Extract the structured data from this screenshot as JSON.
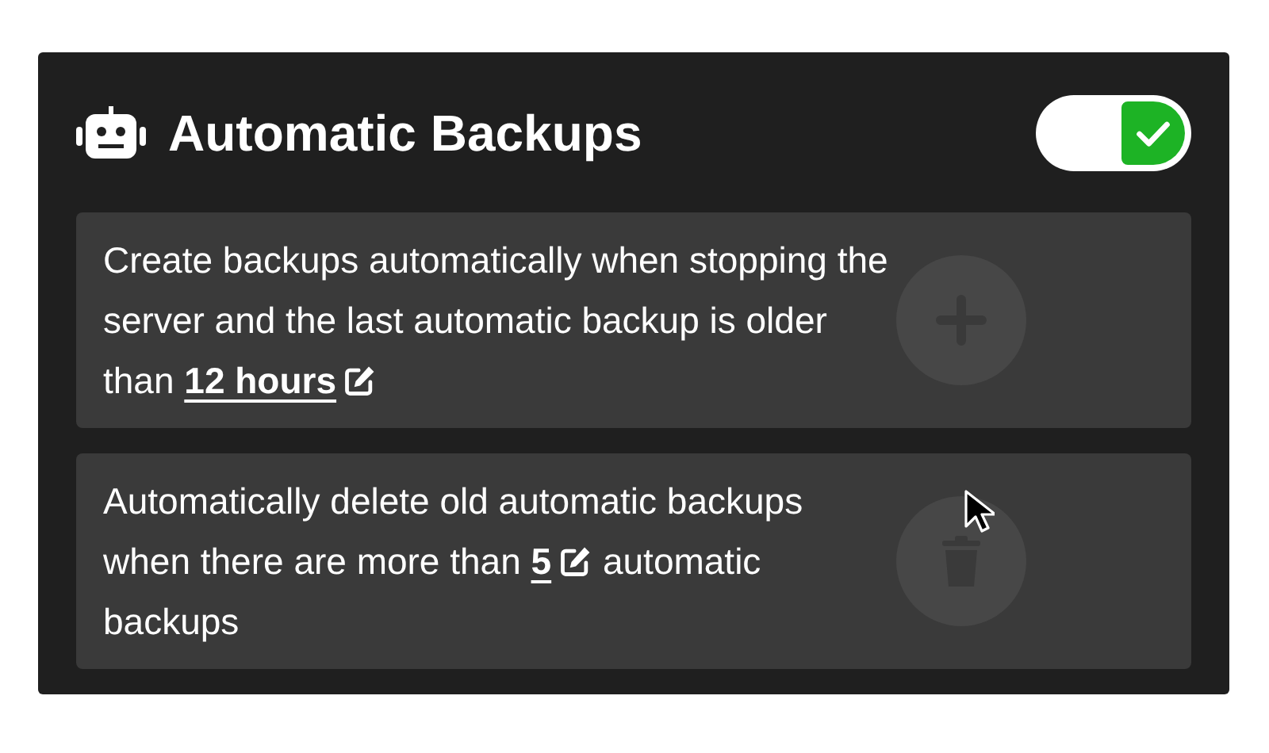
{
  "header": {
    "title": "Automatic Backups",
    "toggle": {
      "on": true
    }
  },
  "rows": [
    {
      "kind": "add",
      "before": "Create backups automatically when stopping the server and the last automatic backup is older than ",
      "link": "12 hours",
      "after": ""
    },
    {
      "kind": "delete",
      "before": "Automatically delete old automatic backups when there are more than ",
      "link": "5",
      "after": " automatic backups"
    }
  ]
}
